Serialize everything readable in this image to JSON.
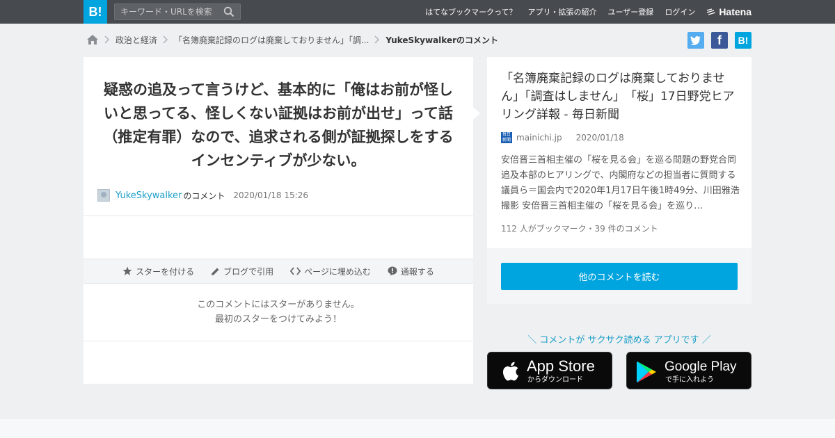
{
  "header": {
    "logo": "B!",
    "search_placeholder": "キーワード・URLを検索",
    "nav": [
      "はてなブックマークって？",
      "アプリ・拡張の紹介",
      "ユーザー登録",
      "ログイン"
    ],
    "brand": "Hatena"
  },
  "breadcrumb": {
    "category": "政治と経済",
    "entry": "「名簿廃棄記録のログは廃棄しておりません」「調...",
    "current": "YukeSkywalkerのコメント"
  },
  "share": {
    "hatena_label": "B!"
  },
  "comment": {
    "text": "疑惑の追及って言うけど、基本的に「俺はお前が怪しいと思ってる、怪しくない証拠はお前が出せ」って話（推定有罪）なので、追求される側が証拠探しをするインセンティブが少ない。",
    "user": "YukeSkywalker",
    "user_suffix": "のコメント",
    "datetime": "2020/01/18 15:26"
  },
  "actions": {
    "star": "スターを付ける",
    "blog": "ブログで引用",
    "embed": "ページに埋め込む",
    "report": "通報する"
  },
  "stars": {
    "line1": "このコメントにはスターがありません。",
    "line2": "最初のスターをつけてみよう！"
  },
  "entry": {
    "title": "「名簿廃棄記録のログは廃棄しておりません」「調査はしません」　「桜」17日野党ヒアリング詳報 - 毎日新聞",
    "favicon_text": "毎日新聞",
    "domain": "mainichi.jp",
    "date": "2020/01/18",
    "description": "安倍晋三首相主催の「桜を見る会」を巡る問題の野党合同追及本部のヒアリングで、内閣府などの担当者に質問する議員ら＝国会内で2020年1月17日午後1時49分、川田雅浩撮影 安倍晋三首相主催の「桜を見る会」を巡り…",
    "stats": "112 人がブックマーク・39 件のコメント",
    "read_more": "他のコメントを読む"
  },
  "app": {
    "promo": "＼ コメントが サクサク読める アプリです ／",
    "appstore_big": "App Store",
    "appstore_small": "からダウンロード",
    "googleplay_big": "Google Play",
    "googleplay_small": "で手に入れよう"
  },
  "colors": {
    "brand_blue": "#00a4de",
    "topbar": "#474a4e",
    "twitter": "#55acee",
    "facebook": "#3b5998"
  }
}
